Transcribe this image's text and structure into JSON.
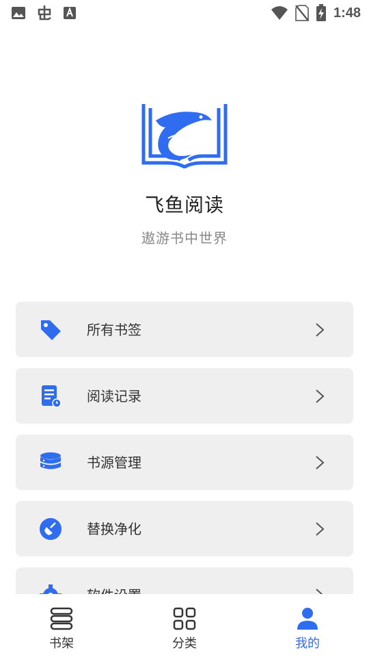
{
  "status_bar": {
    "time": "1:48",
    "icons_left": [
      "image-icon",
      "bug-icon",
      "font-icon"
    ],
    "icons_right": [
      "wifi-icon",
      "no-sim-icon",
      "battery-charging-icon"
    ]
  },
  "header": {
    "title": "飞鱼阅读",
    "slogan": "遨游书中世界",
    "logo_icon": "book-fish-logo"
  },
  "menu": {
    "items": [
      {
        "label": "所有书签",
        "icon": "tag-icon"
      },
      {
        "label": "阅读记录",
        "icon": "document-clock-icon"
      },
      {
        "label": "书源管理",
        "icon": "database-icon"
      },
      {
        "label": "替换净化",
        "icon": "broom-icon"
      },
      {
        "label": "软件设置",
        "icon": "gear-icon"
      }
    ]
  },
  "bottom_nav": {
    "items": [
      {
        "label": "书架",
        "icon": "bookshelf-icon",
        "active": false
      },
      {
        "label": "分类",
        "icon": "grid-icon",
        "active": false
      },
      {
        "label": "我的",
        "icon": "person-icon",
        "active": true
      }
    ]
  },
  "colors": {
    "accent": "#2f6cf0",
    "card_bg": "#efefef",
    "text": "#333333",
    "subtext": "#888888"
  }
}
